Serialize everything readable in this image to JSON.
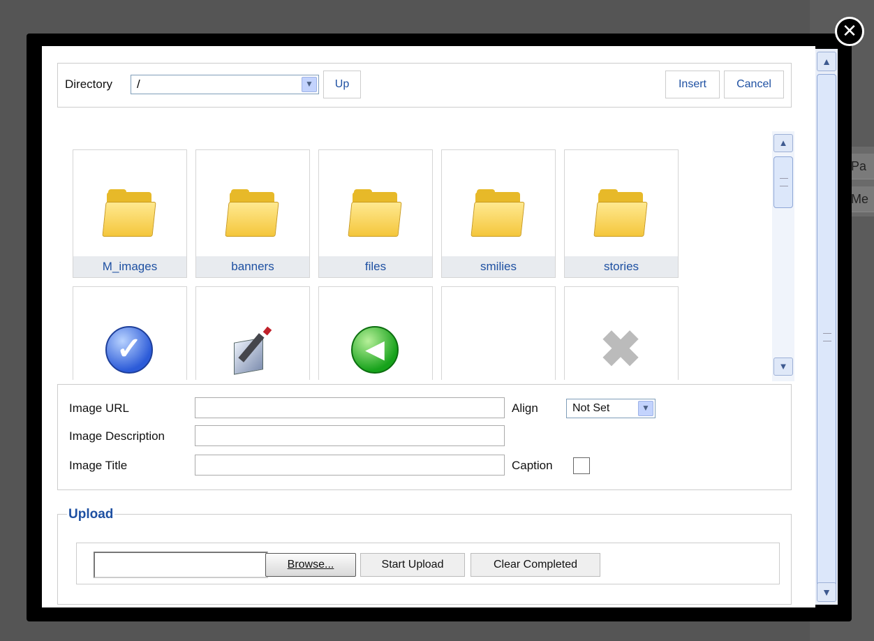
{
  "background": {
    "right_labels": [
      "Pa",
      "Me"
    ]
  },
  "dialog": {
    "close_glyph": "✕",
    "directory": {
      "label": "Directory",
      "value": "/",
      "up_label": "Up",
      "insert_label": "Insert",
      "cancel_label": "Cancel"
    },
    "items": [
      {
        "name": "M_images",
        "kind": "folder",
        "icon": "folder-icon"
      },
      {
        "name": "banners",
        "kind": "folder",
        "icon": "folder-icon"
      },
      {
        "name": "files",
        "kind": "folder",
        "icon": "folder-icon"
      },
      {
        "name": "smilies",
        "kind": "folder",
        "icon": "folder-icon"
      },
      {
        "name": "stories",
        "kind": "folder",
        "icon": "folder-icon"
      },
      {
        "name": "",
        "kind": "image",
        "icon": "check-icon"
      },
      {
        "name": "",
        "kind": "image",
        "icon": "edit-icon"
      },
      {
        "name": "",
        "kind": "image",
        "icon": "back-arrow-icon"
      },
      {
        "name": "",
        "kind": "image",
        "icon": "blank-icon"
      },
      {
        "name": "",
        "kind": "image",
        "icon": "delete-x-icon"
      }
    ],
    "properties": {
      "image_url_label": "Image URL",
      "image_url_value": "",
      "image_description_label": "Image Description",
      "image_description_value": "",
      "image_title_label": "Image Title",
      "image_title_value": "",
      "align_label": "Align",
      "align_value": "Not Set",
      "caption_label": "Caption",
      "caption_checked": false
    },
    "upload": {
      "legend": "Upload",
      "file_value": "",
      "browse_label": "Browse...",
      "start_label": "Start Upload",
      "clear_label": "Clear Completed"
    }
  },
  "colors": {
    "link_blue": "#1e50a2",
    "folder_yellow": "#f4c63c",
    "frame": "#000000"
  }
}
